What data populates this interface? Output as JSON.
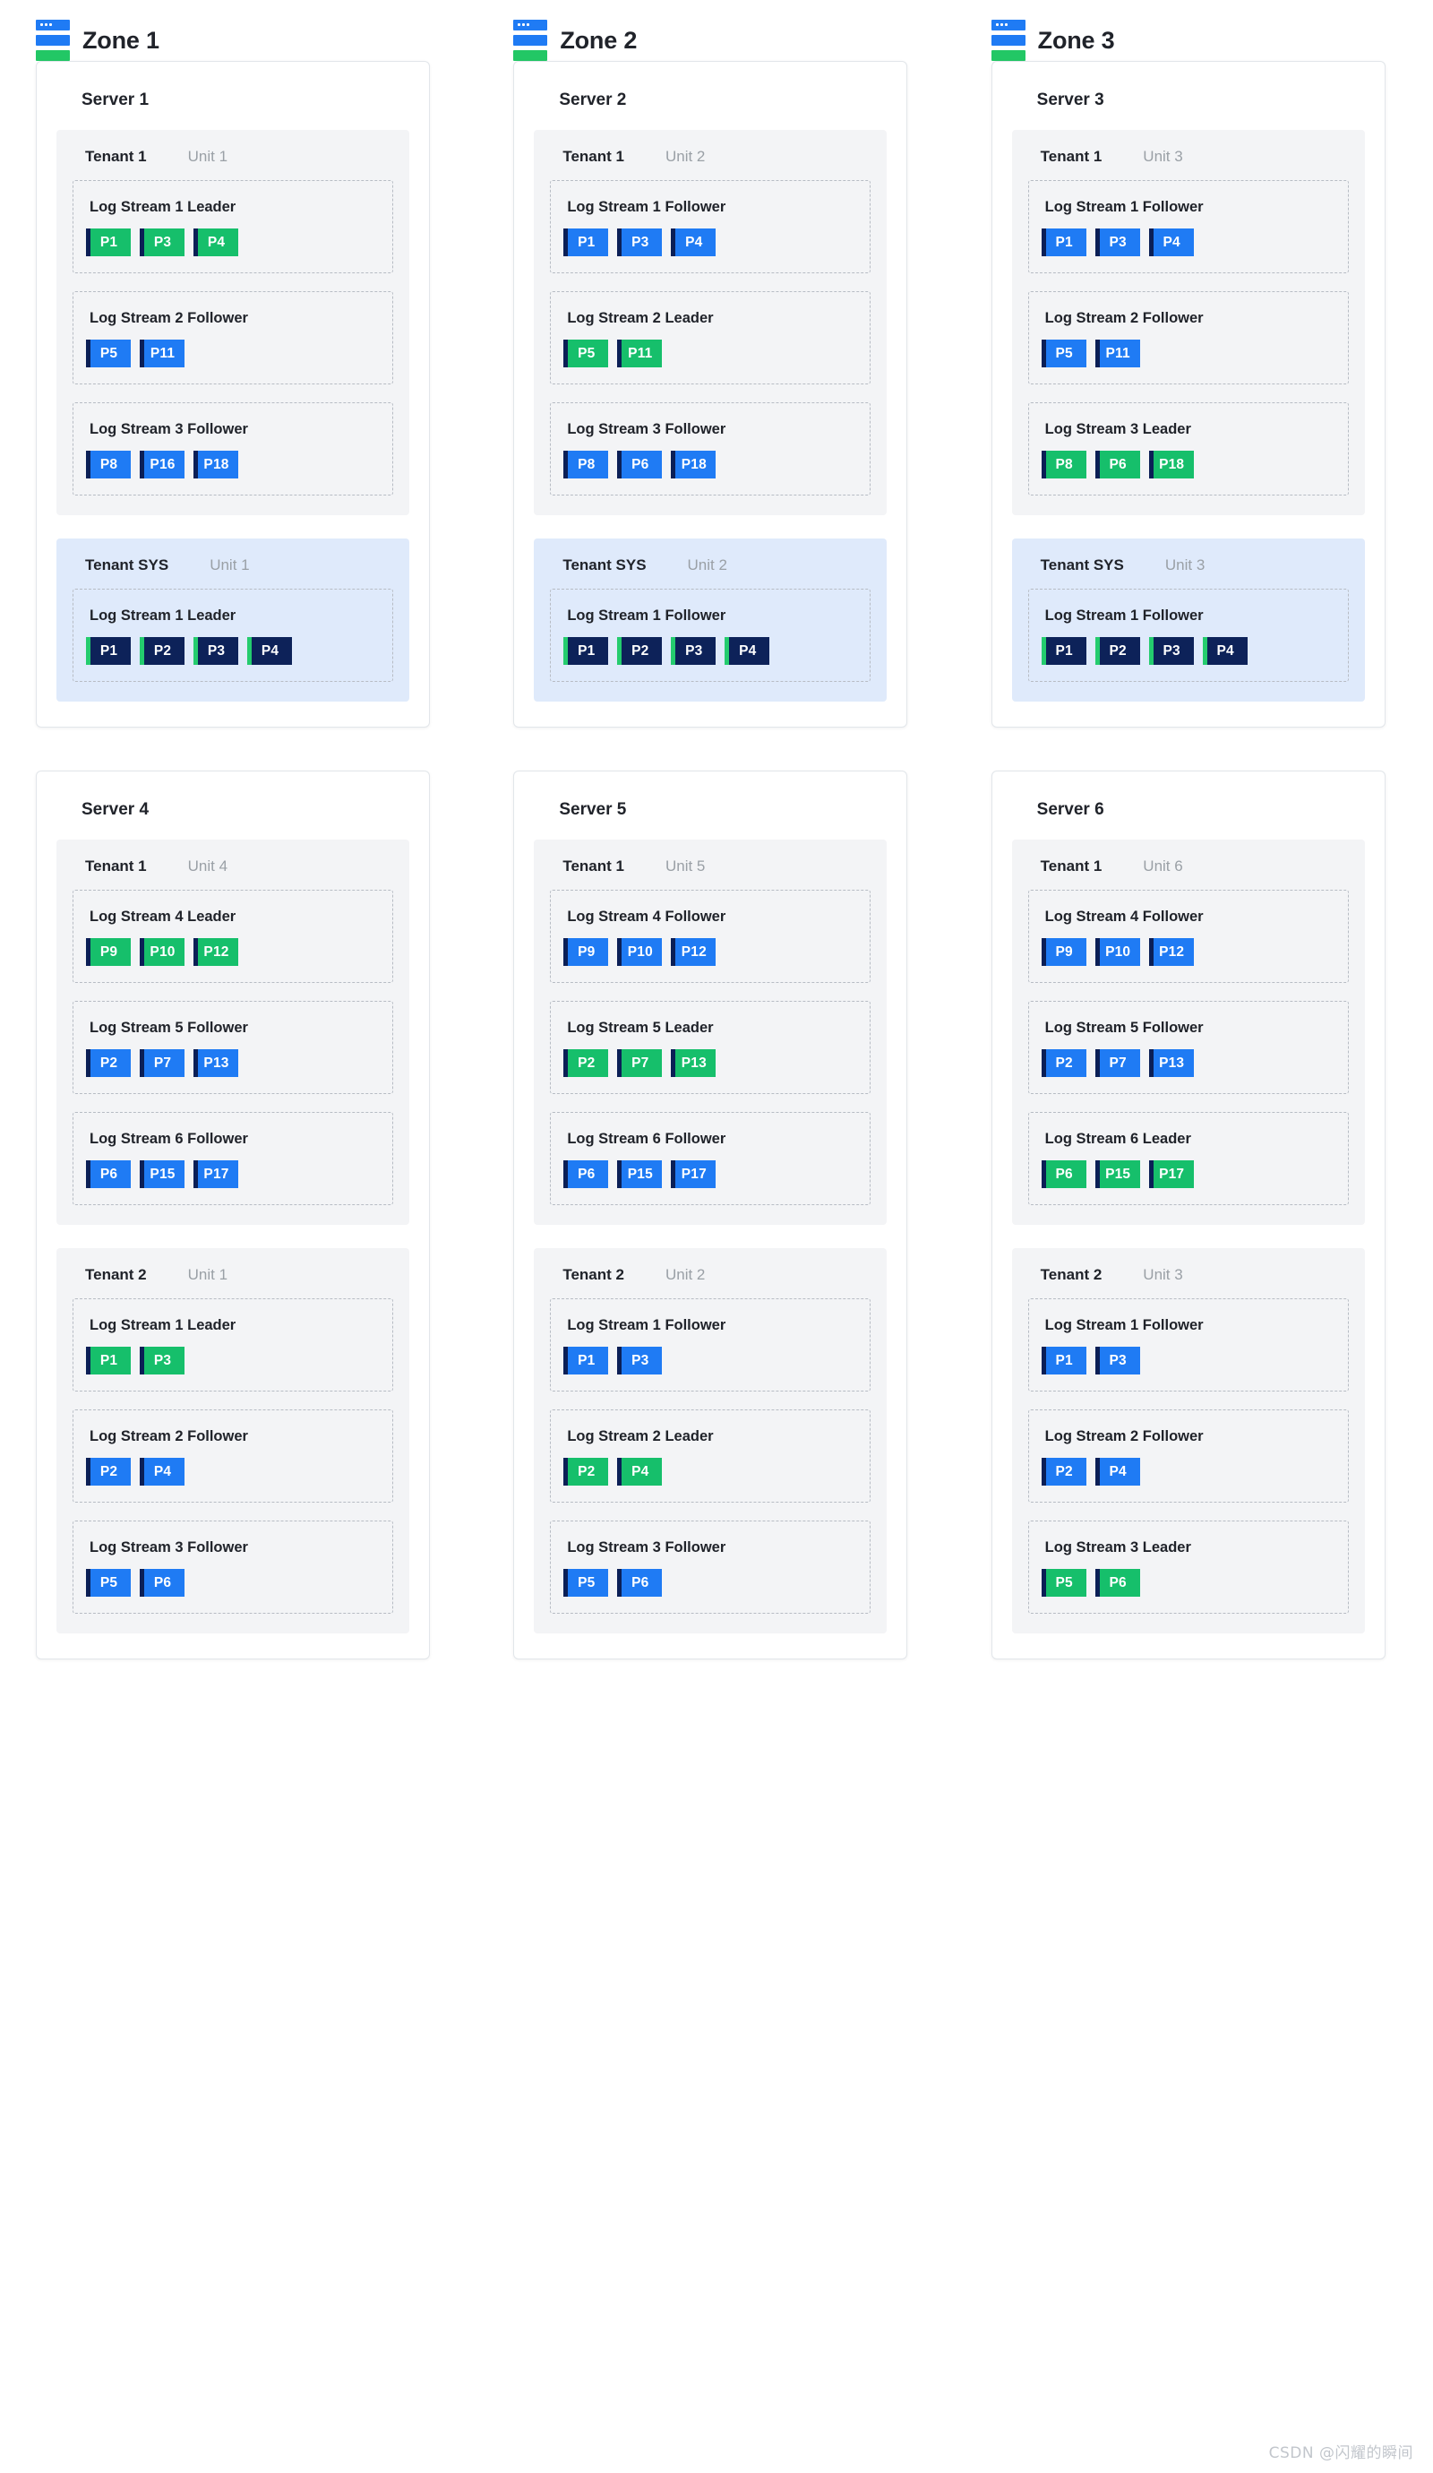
{
  "zones": [
    {
      "label": "Zone 1",
      "icon": "server-stack-icon"
    },
    {
      "label": "Zone 2",
      "icon": "server-stack-icon"
    },
    {
      "label": "Zone 3",
      "icon": "server-stack-icon"
    }
  ],
  "watermark": "CSDN @闪耀的瞬间",
  "colors": {
    "leader": "#16bf6b",
    "follower": "#1f7bf4",
    "sys_chip_bg": "#0d2259",
    "sys_chip_stripe": "#24cc6e",
    "chip_stripe": "#0b1f56",
    "tenant_bg": "#f3f4f6",
    "tenant_sys_bg": "#dfeafb",
    "card_border": "#e2e6ea",
    "dashed_border": "#b7bcc4",
    "unit_text": "#9aa0a6"
  },
  "rows": [
    {
      "servers": [
        {
          "title": "Server 1",
          "tenants": [
            {
              "name": "Tenant 1",
              "unit": "Unit 1",
              "variant": "normal",
              "streams": [
                {
                  "title": "Log Stream 1 Leader",
                  "role": "leader",
                  "partitions": [
                    "P1",
                    "P3",
                    "P4"
                  ]
                },
                {
                  "title": "Log Stream 2 Follower",
                  "role": "follower",
                  "partitions": [
                    "P5",
                    "P11"
                  ]
                },
                {
                  "title": "Log Stream 3 Follower",
                  "role": "follower",
                  "partitions": [
                    "P8",
                    "P16",
                    "P18"
                  ]
                }
              ]
            },
            {
              "name": "Tenant SYS",
              "unit": "Unit 1",
              "variant": "sys",
              "streams": [
                {
                  "title": "Log Stream 1 Leader",
                  "role": "sys",
                  "partitions": [
                    "P1",
                    "P2",
                    "P3",
                    "P4"
                  ]
                }
              ]
            }
          ]
        },
        {
          "title": "Server 2",
          "tenants": [
            {
              "name": "Tenant 1",
              "unit": "Unit 2",
              "variant": "normal",
              "streams": [
                {
                  "title": "Log Stream 1 Follower",
                  "role": "follower",
                  "partitions": [
                    "P1",
                    "P3",
                    "P4"
                  ]
                },
                {
                  "title": "Log Stream 2 Leader",
                  "role": "leader",
                  "partitions": [
                    "P5",
                    "P11"
                  ]
                },
                {
                  "title": "Log Stream 3 Follower",
                  "role": "follower",
                  "partitions": [
                    "P8",
                    "P6",
                    "P18"
                  ]
                }
              ]
            },
            {
              "name": "Tenant SYS",
              "unit": "Unit 2",
              "variant": "sys",
              "streams": [
                {
                  "title": "Log Stream 1 Follower",
                  "role": "sys",
                  "partitions": [
                    "P1",
                    "P2",
                    "P3",
                    "P4"
                  ]
                }
              ]
            }
          ]
        },
        {
          "title": "Server 3",
          "tenants": [
            {
              "name": "Tenant 1",
              "unit": "Unit 3",
              "variant": "normal",
              "streams": [
                {
                  "title": "Log Stream 1 Follower",
                  "role": "follower",
                  "partitions": [
                    "P1",
                    "P3",
                    "P4"
                  ]
                },
                {
                  "title": "Log Stream 2 Follower",
                  "role": "follower",
                  "partitions": [
                    "P5",
                    "P11"
                  ]
                },
                {
                  "title": "Log Stream 3 Leader",
                  "role": "leader",
                  "partitions": [
                    "P8",
                    "P6",
                    "P18"
                  ]
                }
              ]
            },
            {
              "name": "Tenant SYS",
              "unit": "Unit 3",
              "variant": "sys",
              "streams": [
                {
                  "title": "Log Stream 1 Follower",
                  "role": "sys",
                  "partitions": [
                    "P1",
                    "P2",
                    "P3",
                    "P4"
                  ]
                }
              ]
            }
          ]
        }
      ]
    },
    {
      "servers": [
        {
          "title": "Server 4",
          "tenants": [
            {
              "name": "Tenant 1",
              "unit": "Unit 4",
              "variant": "normal",
              "streams": [
                {
                  "title": "Log Stream 4 Leader",
                  "role": "leader",
                  "partitions": [
                    "P9",
                    "P10",
                    "P12"
                  ]
                },
                {
                  "title": "Log Stream 5 Follower",
                  "role": "follower",
                  "partitions": [
                    "P2",
                    "P7",
                    "P13"
                  ]
                },
                {
                  "title": "Log Stream 6 Follower",
                  "role": "follower",
                  "partitions": [
                    "P6",
                    "P15",
                    "P17"
                  ]
                }
              ]
            },
            {
              "name": "Tenant 2",
              "unit": "Unit 1",
              "variant": "normal",
              "streams": [
                {
                  "title": "Log Stream 1 Leader",
                  "role": "leader",
                  "partitions": [
                    "P1",
                    "P3"
                  ]
                },
                {
                  "title": "Log Stream 2 Follower",
                  "role": "follower",
                  "partitions": [
                    "P2",
                    "P4"
                  ]
                },
                {
                  "title": "Log Stream 3 Follower",
                  "role": "follower",
                  "partitions": [
                    "P5",
                    "P6"
                  ]
                }
              ]
            }
          ]
        },
        {
          "title": "Server 5",
          "tenants": [
            {
              "name": "Tenant 1",
              "unit": "Unit 5",
              "variant": "normal",
              "streams": [
                {
                  "title": "Log Stream 4 Follower",
                  "role": "follower",
                  "partitions": [
                    "P9",
                    "P10",
                    "P12"
                  ]
                },
                {
                  "title": "Log Stream 5 Leader",
                  "role": "leader",
                  "partitions": [
                    "P2",
                    "P7",
                    "P13"
                  ]
                },
                {
                  "title": "Log Stream 6 Follower",
                  "role": "follower",
                  "partitions": [
                    "P6",
                    "P15",
                    "P17"
                  ]
                }
              ]
            },
            {
              "name": "Tenant 2",
              "unit": "Unit 2",
              "variant": "normal",
              "streams": [
                {
                  "title": "Log Stream 1 Follower",
                  "role": "follower",
                  "partitions": [
                    "P1",
                    "P3"
                  ]
                },
                {
                  "title": "Log Stream 2 Leader",
                  "role": "leader",
                  "partitions": [
                    "P2",
                    "P4"
                  ]
                },
                {
                  "title": "Log Stream 3 Follower",
                  "role": "follower",
                  "partitions": [
                    "P5",
                    "P6"
                  ]
                }
              ]
            }
          ]
        },
        {
          "title": "Server 6",
          "tenants": [
            {
              "name": "Tenant 1",
              "unit": "Unit 6",
              "variant": "normal",
              "streams": [
                {
                  "title": "Log Stream 4 Follower",
                  "role": "follower",
                  "partitions": [
                    "P9",
                    "P10",
                    "P12"
                  ]
                },
                {
                  "title": "Log Stream 5 Follower",
                  "role": "follower",
                  "partitions": [
                    "P2",
                    "P7",
                    "P13"
                  ]
                },
                {
                  "title": "Log Stream 6 Leader",
                  "role": "leader",
                  "partitions": [
                    "P6",
                    "P15",
                    "P17"
                  ]
                }
              ]
            },
            {
              "name": "Tenant 2",
              "unit": "Unit 3",
              "variant": "normal",
              "streams": [
                {
                  "title": "Log Stream 1 Follower",
                  "role": "follower",
                  "partitions": [
                    "P1",
                    "P3"
                  ]
                },
                {
                  "title": "Log Stream 2 Follower",
                  "role": "follower",
                  "partitions": [
                    "P2",
                    "P4"
                  ]
                },
                {
                  "title": "Log Stream 3 Leader",
                  "role": "leader",
                  "partitions": [
                    "P5",
                    "P6"
                  ]
                }
              ]
            }
          ]
        }
      ]
    }
  ]
}
